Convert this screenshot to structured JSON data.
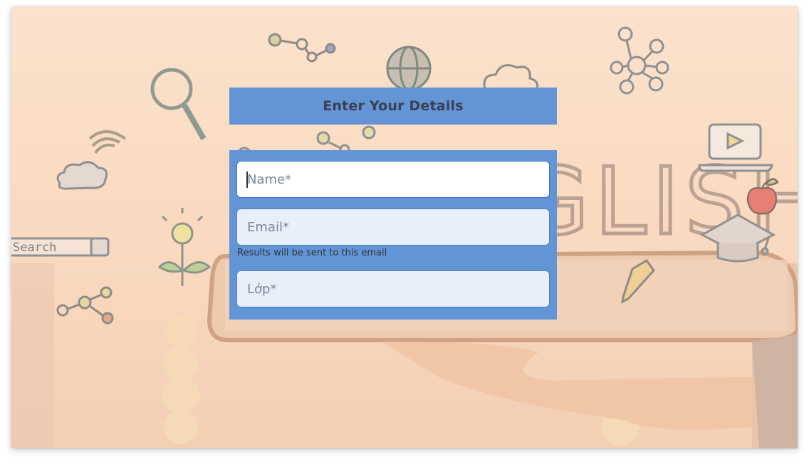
{
  "form": {
    "title": "Enter Your Details",
    "name_placeholder": "Name*",
    "email_placeholder": "Email*",
    "email_hint": "Results will be sent to this email",
    "class_placeholder": "Lớp*"
  },
  "background": {
    "headline": "ENGLISH",
    "search_label": "Search"
  },
  "colors": {
    "panel": "#6395d6",
    "field": "#e8effb",
    "active_field": "#ffffff",
    "background": "#fbe2cc"
  },
  "icons": [
    "magnifier-icon",
    "globe-icon",
    "cloud-icon",
    "network-icon",
    "wifi-icon",
    "lightbulb-icon",
    "laptop-icon",
    "apple-icon",
    "graduation-cap-icon",
    "pencil-icon",
    "microphone-icon",
    "molecule-icon",
    "tablet-icon"
  ]
}
